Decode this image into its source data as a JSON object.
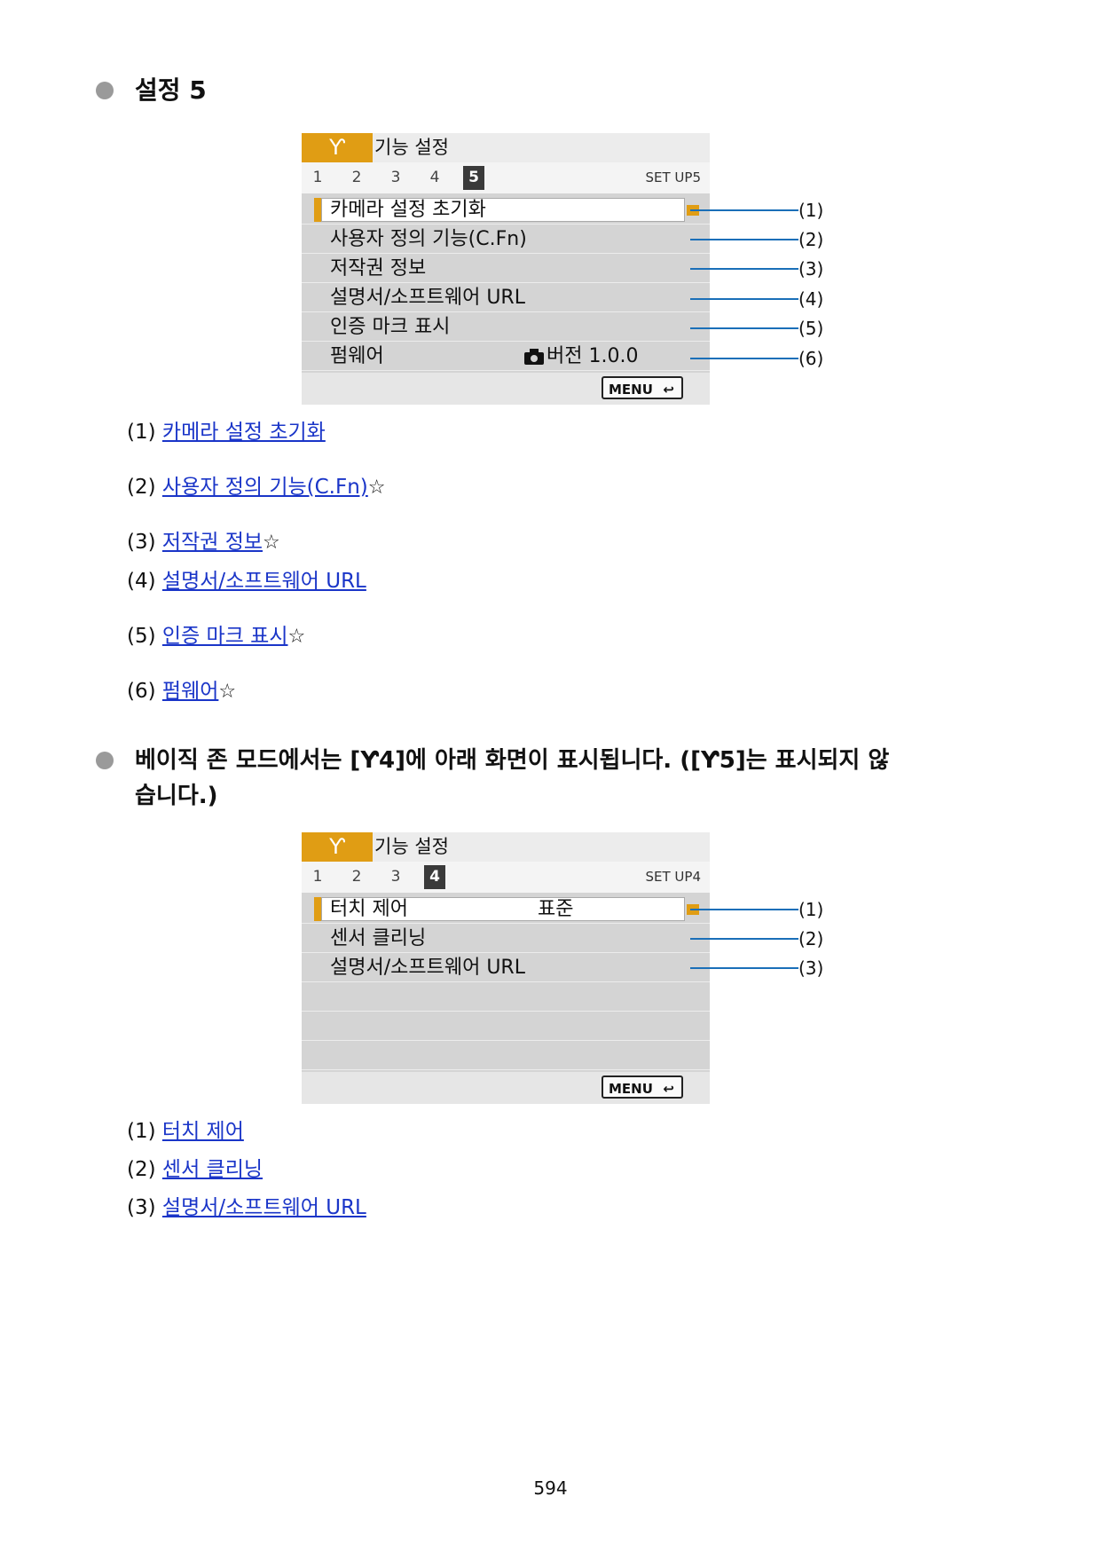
{
  "section1": {
    "bullet_title": "설정 5"
  },
  "screen1": {
    "title": "기능 설정",
    "wrench_glyph": "Ƴ",
    "tabs": [
      "1",
      "2",
      "3",
      "4",
      "5"
    ],
    "setup_label": "SET UP5",
    "rows": [
      {
        "label": "카메라 설정 초기화",
        "value": ""
      },
      {
        "label": "사용자 정의 기능(C.Fn)",
        "value": ""
      },
      {
        "label": "저작권 정보",
        "value": ""
      },
      {
        "label": "설명서/소프트웨어 URL",
        "value": ""
      },
      {
        "label": "인증 마크 표시",
        "value": ""
      },
      {
        "label": "펌웨어",
        "value": "버전 1.0.0"
      }
    ],
    "menu_label": "MENU",
    "callouts": [
      "(1)",
      "(2)",
      "(3)",
      "(4)",
      "(5)",
      "(6)"
    ]
  },
  "refs1": [
    {
      "num": "(1)",
      "link": "카메라 설정 초기화",
      "star": ""
    },
    {
      "num": "(2)",
      "link": "사용자 정의 기능(C.Fn)",
      "star": "☆"
    },
    {
      "num": "(3)",
      "link": "저작권 정보",
      "star": "☆"
    },
    {
      "num": "(4)",
      "link": "설명서/소프트웨어 URL",
      "star": ""
    },
    {
      "num": "(5)",
      "link": "인증 마크 표시",
      "star": "☆"
    },
    {
      "num": "(6)",
      "link": "펌웨어",
      "star": "☆"
    }
  ],
  "section2": {
    "bullet_line1": "베이직 존 모드에서는 [Ƴ4]에 아래 화면이 표시됩니다. ([Ƴ5]는 표시되지 않",
    "bullet_line2": "습니다.)"
  },
  "screen2": {
    "title": "기능 설정",
    "wrench_glyph": "Ƴ",
    "tabs": [
      "1",
      "2",
      "3",
      "4"
    ],
    "setup_label": "SET UP4",
    "rows": [
      {
        "label": "터치 제어",
        "value": "표준"
      },
      {
        "label": "센서 클리닝",
        "value": ""
      },
      {
        "label": "설명서/소프트웨어 URL",
        "value": ""
      },
      {
        "label": "",
        "value": ""
      },
      {
        "label": "",
        "value": ""
      },
      {
        "label": "",
        "value": ""
      }
    ],
    "menu_label": "MENU",
    "callouts": [
      "(1)",
      "(2)",
      "(3)"
    ]
  },
  "refs2": [
    {
      "num": "(1)",
      "link": "터치 제어"
    },
    {
      "num": "(2)",
      "link": "센서 클리닝"
    },
    {
      "num": "(3)",
      "link": "설명서/소프트웨어 URL"
    }
  ],
  "page_number": "594",
  "colors": {
    "accent": "#e09d14",
    "link": "#1a35c8",
    "callout": "#1a6fb8",
    "screen_bg": "#d4d4d4"
  }
}
